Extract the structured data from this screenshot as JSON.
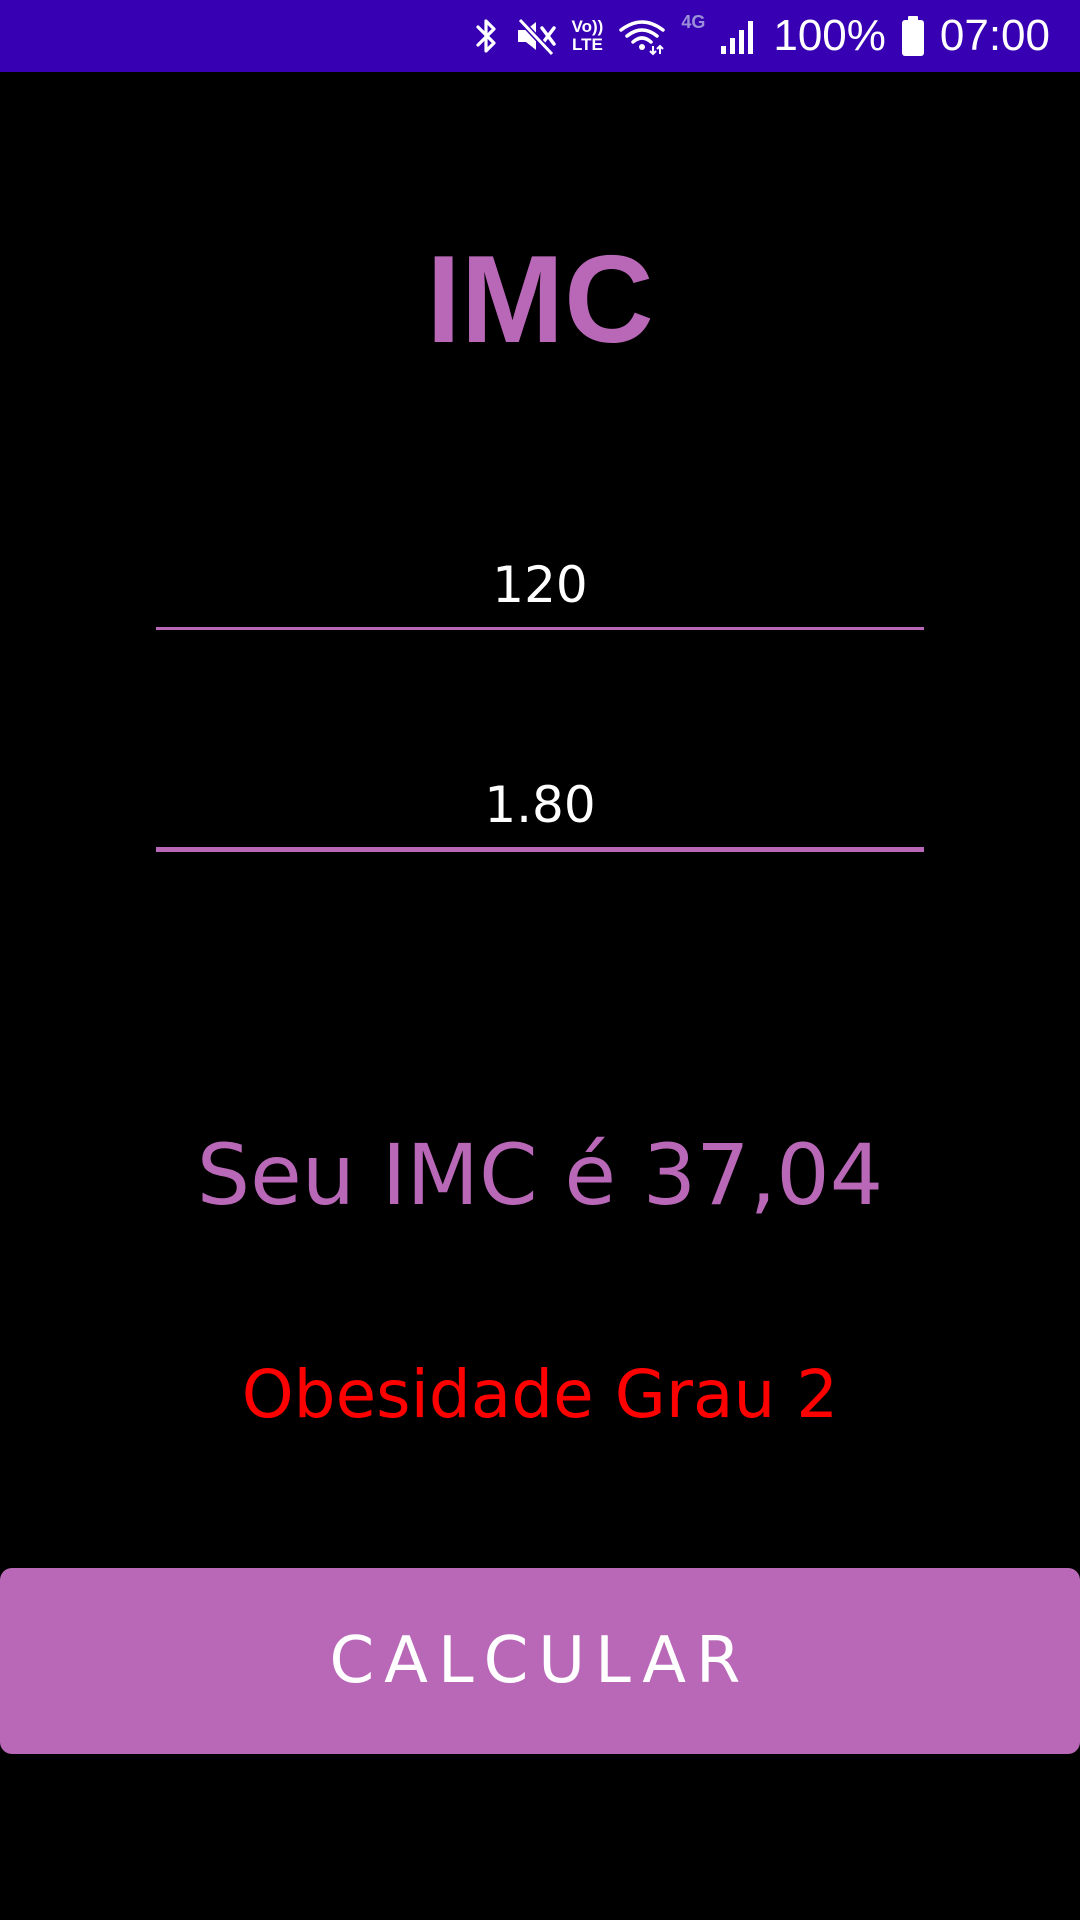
{
  "status_bar": {
    "volte_top": "Vo))",
    "volte_bottom": "LTE",
    "network": "4G",
    "battery": "100%",
    "time": "07:00",
    "background": "#3700b3",
    "icons": [
      "bluetooth-icon",
      "mute-icon",
      "volte-icon",
      "wifi-icon",
      "signal-icon",
      "battery-icon"
    ]
  },
  "app": {
    "title": "IMC",
    "accent": "#b968b8"
  },
  "inputs": {
    "weight_value": "120",
    "height_value": "1.80"
  },
  "result": {
    "text": "Seu IMC é 37,04",
    "classification": "Obesidade Grau 2",
    "classification_color": "#ff0000"
  },
  "button": {
    "label": "CALCULAR"
  }
}
